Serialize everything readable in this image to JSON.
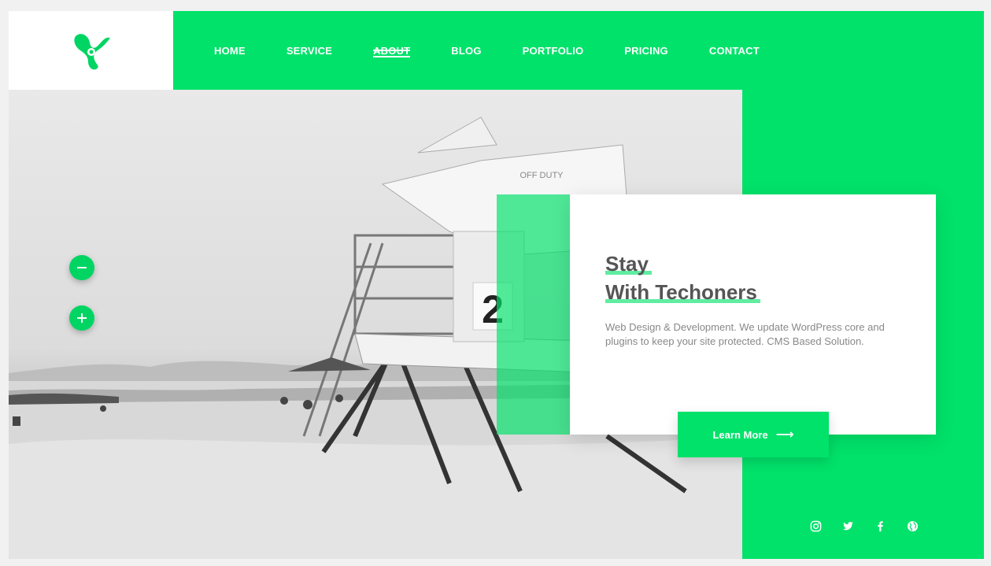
{
  "nav": {
    "items": [
      {
        "label": "HOME"
      },
      {
        "label": "SERVICE"
      },
      {
        "label": "ABOUT"
      },
      {
        "label": "BLOG"
      },
      {
        "label": "PORTFOLIO"
      },
      {
        "label": "PRICING"
      },
      {
        "label": "CONTACT"
      }
    ],
    "active": "ABOUT"
  },
  "hero": {
    "tower_sign": "OFF DUTY",
    "tower_number": "2"
  },
  "controls": {
    "minus_icon": "minus-icon",
    "plus_icon": "plus-icon"
  },
  "card": {
    "title_line1": "Stay",
    "title_line2": "With Techoners",
    "description": "Web Design & Development. We update WordPress core and plugins to keep your site protected. CMS Based Solution."
  },
  "cta": {
    "label": "Learn More",
    "icon": "arrow-right-icon"
  },
  "social": [
    "instagram-icon",
    "twitter-icon",
    "facebook-icon",
    "globe-icon"
  ],
  "colors": {
    "accent": "#00e26a",
    "text_dark": "#555555",
    "text_muted": "#888888"
  }
}
